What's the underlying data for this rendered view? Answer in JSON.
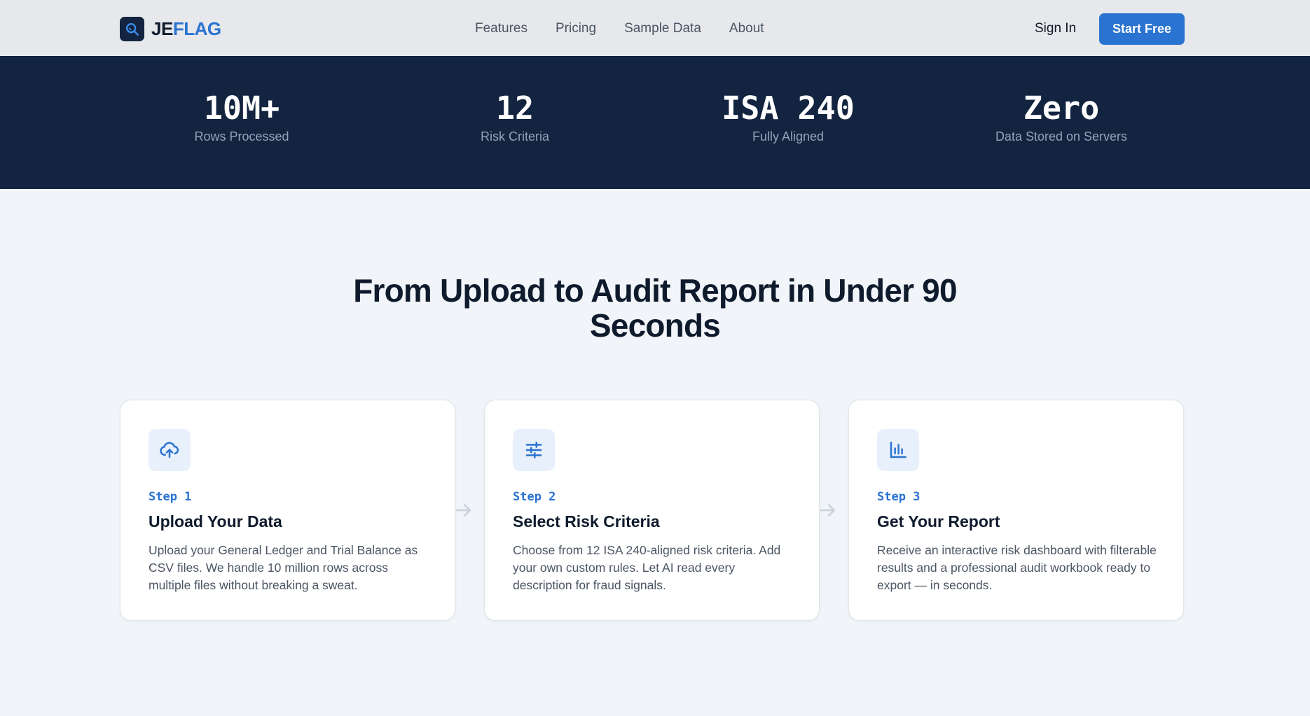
{
  "nav": {
    "logo_je": "JE",
    "logo_flag": "FLAG",
    "logo_icon": "search-icon",
    "links": [
      "Features",
      "Pricing",
      "Sample Data",
      "About"
    ],
    "sign_in": "Sign In",
    "start_free": "Start Free"
  },
  "stats": [
    {
      "value": "10M+",
      "label": "Rows Processed"
    },
    {
      "value": "12",
      "label": "Risk Criteria"
    },
    {
      "value": "ISA 240",
      "label": "Fully Aligned"
    },
    {
      "value": "Zero",
      "label": "Data Stored on Servers"
    }
  ],
  "section": {
    "title": "From Upload to Audit Report in Under 90 Seconds"
  },
  "steps": [
    {
      "icon": "upload-cloud-icon",
      "step": "Step 1",
      "title": "Upload Your Data",
      "description": "Upload your General Ledger and Trial Balance as CSV files. We handle 10 million rows across multiple files without breaking a sweat."
    },
    {
      "icon": "sliders-icon",
      "step": "Step 2",
      "title": "Select Risk Criteria",
      "description": "Choose from 12 ISA 240-aligned risk criteria. Add your own custom rules. Let AI read every description for fraud signals."
    },
    {
      "icon": "bar-chart-icon",
      "step": "Step 3",
      "title": "Get Your Report",
      "description": "Receive an interactive risk dashboard with filterable results and a professional audit workbook ready to export — in seconds."
    }
  ],
  "colors": {
    "accent": "#2a73d1",
    "navy": "#12243f",
    "background": "#f1f4f8"
  }
}
